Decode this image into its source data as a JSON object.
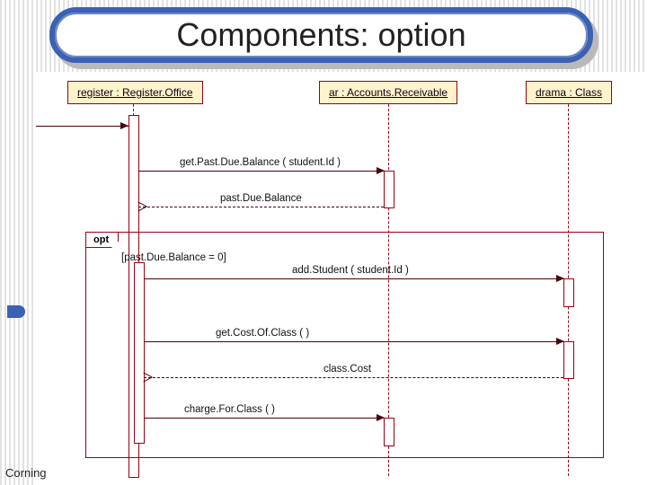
{
  "slide": {
    "title": "Components: option",
    "footer": "Corning"
  },
  "participants": {
    "register": "register : Register.Office",
    "ar": "ar : Accounts.Receivable",
    "drama": "drama : Class"
  },
  "frame": {
    "label": "opt",
    "guard": "[past.Due.Balance = 0]"
  },
  "messages": {
    "m1": "get.Past.Due.Balance ( student.Id )",
    "r1": "past.Due.Balance",
    "m2": "add.Student ( student.Id )",
    "m3": "get.Cost.Of.Class (  )",
    "r3": "class.Cost",
    "m4": "charge.For.Class (  )"
  },
  "chart_data": {
    "type": "table",
    "title": "UML sequence diagram – option fragment",
    "participants": [
      "register : Register.Office",
      "ar : Accounts.Receivable",
      "drama : Class"
    ],
    "events": [
      {
        "from": "register",
        "to": "ar",
        "kind": "sync",
        "label": "get.Past.Due.Balance ( student.Id )"
      },
      {
        "from": "ar",
        "to": "register",
        "kind": "return",
        "label": "past.Due.Balance"
      },
      {
        "fragment": "opt",
        "guard": "[past.Due.Balance = 0]",
        "events": [
          {
            "from": "register",
            "to": "drama",
            "kind": "sync",
            "label": "add.Student ( student.Id )"
          },
          {
            "from": "register",
            "to": "drama",
            "kind": "sync",
            "label": "get.Cost.Of.Class (  )"
          },
          {
            "from": "drama",
            "to": "register",
            "kind": "return",
            "label": "class.Cost"
          },
          {
            "from": "register",
            "to": "ar",
            "kind": "sync",
            "label": "charge.For.Class (  )"
          }
        ]
      }
    ]
  }
}
